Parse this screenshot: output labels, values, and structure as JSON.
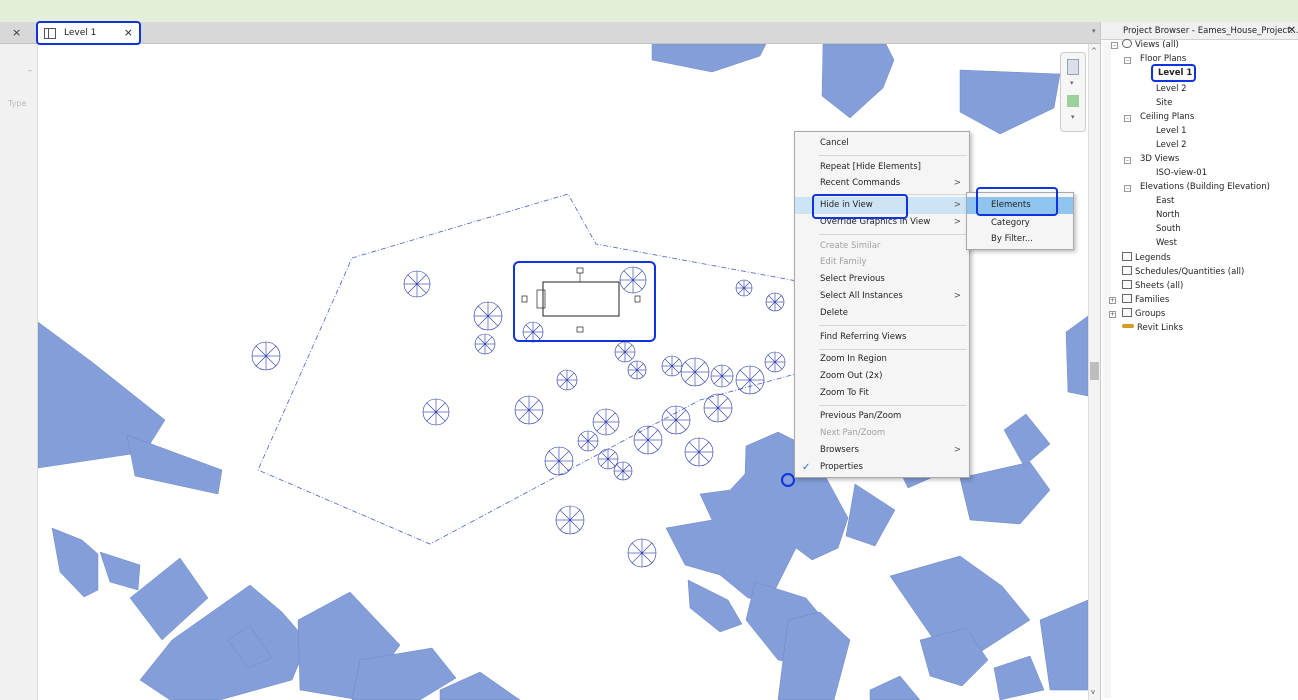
{
  "tab": {
    "label": "Level 1",
    "close": "×",
    "close_left": "×"
  },
  "left_panel": {
    "type_label": "Type",
    "dash": "–"
  },
  "nav": {
    "n2": "▾",
    "n4": "▾"
  },
  "scroll": {
    "up": "^",
    "down": "v"
  },
  "context_menu": {
    "items": [
      {
        "label": "Cancel",
        "disabled": false
      },
      {
        "label": "Repeat [Hide Elements]",
        "disabled": false
      },
      {
        "label": "Recent Commands",
        "disabled": false,
        "submenu": true
      },
      {
        "label": "Hide in View",
        "disabled": false,
        "submenu": true,
        "highlighted": true
      },
      {
        "label": "Override Graphics in View",
        "disabled": false,
        "submenu": true
      },
      {
        "label": "Create Similar",
        "disabled": true
      },
      {
        "label": "Edit Family",
        "disabled": true
      },
      {
        "label": "Select Previous",
        "disabled": false
      },
      {
        "label": "Select All Instances",
        "disabled": false,
        "submenu": true
      },
      {
        "label": "Delete",
        "disabled": false
      },
      {
        "label": "Find Referring Views",
        "disabled": false
      },
      {
        "label": "Zoom In Region",
        "disabled": false
      },
      {
        "label": "Zoom Out (2x)",
        "disabled": false
      },
      {
        "label": "Zoom To Fit",
        "disabled": false
      },
      {
        "label": "Previous Pan/Zoom",
        "disabled": false
      },
      {
        "label": "Next Pan/Zoom",
        "disabled": true
      },
      {
        "label": "Browsers",
        "disabled": false,
        "submenu": true
      },
      {
        "label": "Properties",
        "disabled": false,
        "checked": true
      }
    ],
    "arrow": ">",
    "check": "✓"
  },
  "submenu": {
    "items": [
      {
        "label": "Elements",
        "highlighted": true
      },
      {
        "label": "Category",
        "highlighted": false
      },
      {
        "label": "By Filter...",
        "highlighted": false
      }
    ]
  },
  "project_browser": {
    "title": "Project Browser - Eames_House_Project...",
    "close": "✕",
    "pin": "▾",
    "collapse_glyph": "–",
    "expand_glyph": "+",
    "tree": {
      "views_all": "Views (all)",
      "floor_plans": "Floor Plans",
      "fp_level1": "Level 1",
      "fp_level2": "Level 2",
      "fp_site": "Site",
      "ceiling_plans": "Ceiling Plans",
      "cp_level1": "Level 1",
      "cp_level2": "Level 2",
      "views_3d": "3D Views",
      "iso_view": "ISO-view-01",
      "elevations": "Elevations (Building Elevation)",
      "el_east": "East",
      "el_north": "North",
      "el_south": "South",
      "el_west": "West",
      "legends": "Legends",
      "schedules": "Schedules/Quantities (all)",
      "sheets": "Sheets (all)",
      "families": "Families",
      "groups": "Groups",
      "revit_links": "Revit Links"
    }
  }
}
